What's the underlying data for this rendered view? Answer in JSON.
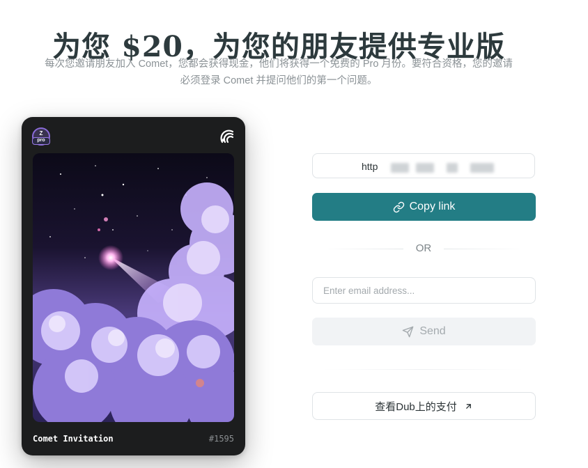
{
  "header": {
    "title": "为您 $20，为您的朋友提供专业版",
    "description": "每次您邀请朋友加入 Comet，您都会获得现金，他们将获得一个免费的 Pro 月份。要符合资格，您的邀请必须登录 Comet 并提问他们的第一个问题。"
  },
  "card": {
    "badge_top": "Z",
    "badge_label": "pro",
    "title": "Comet Invitation",
    "number": "#1595",
    "logo_icon": "comet-logo-icon"
  },
  "referral": {
    "link_visible": "http",
    "link_obscured": true,
    "copy_label": "Copy link",
    "copy_icon": "link-icon",
    "accent": "#237d85"
  },
  "separator": {
    "label": "OR"
  },
  "invite": {
    "email_placeholder": "Enter email address...",
    "email_value": "",
    "send_label": "Send",
    "send_icon": "send-icon"
  },
  "payouts": {
    "label": "查看Dub上的支付",
    "icon": "arrow-up-right-icon"
  }
}
